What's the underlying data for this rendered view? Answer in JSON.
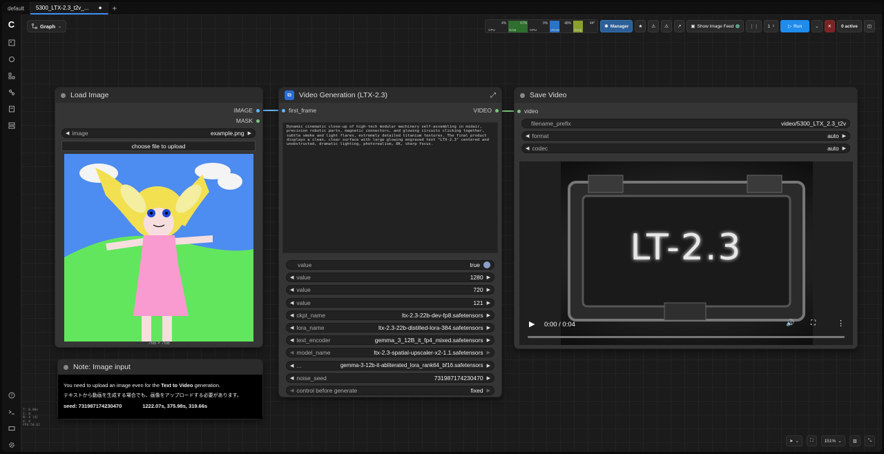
{
  "tabs": [
    {
      "label": "default"
    },
    {
      "label": "5300_LTX-2.3_t2v_...",
      "modified": "●"
    }
  ],
  "tab_add": "+",
  "graph_button": {
    "label": "Graph"
  },
  "toolbar": {
    "stats": [
      {
        "label": "CPU",
        "pct": "4%"
      },
      {
        "label": "RAM",
        "pct": "67%"
      },
      {
        "label": "GPU",
        "pct": "0%"
      },
      {
        "label": "VRAM",
        "pct": "48%"
      },
      {
        "label": "Temp",
        "pct": "44°"
      }
    ],
    "manager": "Manager",
    "show_feed": "Show Image Feed",
    "queue_count": "1",
    "run": "Run",
    "active": "0 active"
  },
  "side_stats": [
    "T: 0.00s",
    "I: 0",
    "N: 4 [4]",
    "V: 0",
    "FPS:50.62"
  ],
  "load_image": {
    "title": "Load Image",
    "outputs": [
      "IMAGE",
      "MASK"
    ],
    "widget_label": "image",
    "widget_value": "example.png",
    "upload": "choose file to upload",
    "size": "768 × 768"
  },
  "video_gen": {
    "title": "Video Generation (LTX-2.3)",
    "input": "first_frame",
    "output": "VIDEO",
    "prompt": "Dynamic cinematic close-up of high-tech modular machinery self-assembling in midair, precision robotic parts, magnetic connectors, and glowing circuits clicking together, subtle smoke and light flares, extremely detailed titanium textures. The final product displays a clean, clear surface with large glowing engraved text \"LTX-2.3\" centered and unobstructed, dramatic lighting, photorealism, 8K, sharp focus.",
    "widgets": [
      {
        "label": "value",
        "value": "true",
        "kind": "toggle"
      },
      {
        "label": "value",
        "value": "1280"
      },
      {
        "label": "value",
        "value": "720"
      },
      {
        "label": "value",
        "value": "121"
      },
      {
        "label": "ckpt_name",
        "value": "ltx-2.3-22b-dev-fp8.safetensors"
      },
      {
        "label": "lora_name",
        "value": "ltx-2.3-22b-distilled-lora-384.safetensors"
      },
      {
        "label": "text_encoder",
        "value": "gemma_3_12B_it_fp4_mixed.safetensors"
      },
      {
        "label": "model_name",
        "value": "ltx-2.3-spatial-upscaler-x2-1.1.safetensors"
      },
      {
        "label": "...",
        "value": "gemma-3-12b-it-abliterated_lora_rank64_bf16.safetensors"
      },
      {
        "label": "noise_seed",
        "value": "731987174230470"
      },
      {
        "label": "control before generate",
        "value": "fixed"
      }
    ]
  },
  "save_video": {
    "title": "Save Video",
    "input": "video",
    "widgets": [
      {
        "label": "filename_prefix",
        "value": "video/5300_LTX_2.3_t2v"
      },
      {
        "label": "format",
        "value": "auto"
      },
      {
        "label": "codec",
        "value": "auto"
      }
    ],
    "overlay_text": "LT-2.3",
    "time": "0:00 / 0:04"
  },
  "note": {
    "title": "Note: Image input",
    "line1_pre": "You need to upload an image even for the ",
    "line1_bold": "Text to Video",
    "line1_post": " generation.",
    "line2": "テキストから動画を生成する場合でも、画像をアップロードする必要があります。",
    "seed": "seed: 731987174230470",
    "timing": "1222.07s, 375.98s, 319.66s"
  },
  "bottom": {
    "zoom": "151%"
  },
  "colors": {
    "accent": "#1f8cec",
    "link_image": "#64b5f6",
    "link_video": "#7bc47f"
  }
}
